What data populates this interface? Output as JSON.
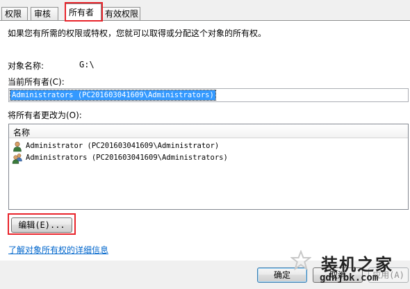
{
  "tabs": [
    {
      "label": "权限"
    },
    {
      "label": "审核"
    },
    {
      "label": "所有者"
    },
    {
      "label": "有效权限"
    }
  ],
  "intro_text": "如果您有所需的权限或特权，您就可以取得或分配这个对象的所有权。",
  "object_name": {
    "label": "对象名称:",
    "value": "G:\\"
  },
  "current_owner": {
    "label": "当前所有者(C):",
    "value": "Administrators (PC201603041609\\Administrators)"
  },
  "change_owner": {
    "label": "将所有者更改为(O):",
    "column_name": "名称",
    "rows": [
      {
        "label": "Administrator (PC201603041609\\Administrator)"
      },
      {
        "label": "Administrators (PC201603041609\\Administrators)"
      }
    ]
  },
  "edit_button": "编辑(E)...",
  "learn_more_link": "了解对象所有权的详细信息",
  "footer": {
    "ok": "确定",
    "cancel": "取消",
    "apply": "应用(A)"
  },
  "watermark": {
    "brand": "装机之家",
    "url": "gdnjbk.com"
  },
  "colors": {
    "highlight": "#e8232a",
    "selection": "#3399ff",
    "link": "#0066cc"
  }
}
